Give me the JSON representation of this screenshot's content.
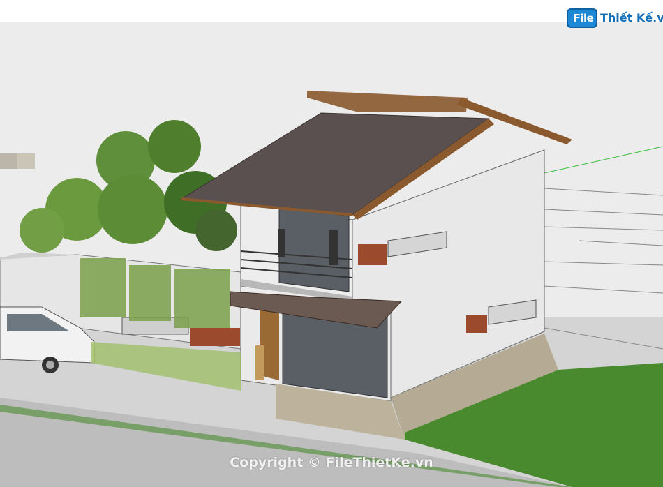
{
  "brand": {
    "badge": "File",
    "name": "Thiết Kế.vn"
  },
  "watermark": "Copyright © FileThietKe.vn",
  "colors": {
    "sky": "#ebebeb",
    "ground": "#cfcfcf",
    "grass": "#4a8a2e",
    "roof": "#5a5050",
    "timber": "#8a5a2e",
    "concrete": "#e9e9e9",
    "brick": "#9c4a2e",
    "brand_blue": "#1d89d6"
  }
}
